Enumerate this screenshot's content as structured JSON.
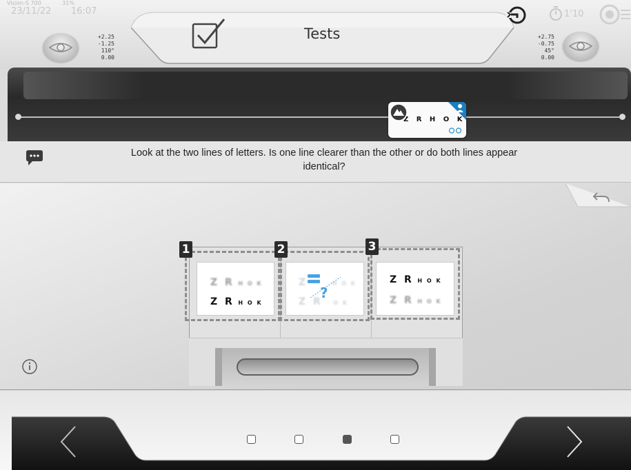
{
  "status": {
    "device_label": "Vision-S 700",
    "battery": "31%",
    "date": "23/11/22",
    "time": "16:07",
    "timer": "1'10"
  },
  "header": {
    "title": "Tests"
  },
  "prescription_left": [
    "+2.25",
    "-1.25",
    "110°",
    "0.00"
  ],
  "prescription_right": [
    "+2.75",
    "-0.75",
    "45°",
    "0.00"
  ],
  "display": {
    "thumbnail_letters": "Z R H O K",
    "accent_color": "#1b7fc0"
  },
  "question": {
    "line1": "Look at the two lines of letters. Is one line clearer than the other or do both lines appear",
    "line2": "identical?"
  },
  "options": [
    {
      "number": "1",
      "top_big": "Z R",
      "top_small": "H O K",
      "bottom_big": "Z R",
      "bottom_small": "H O K"
    },
    {
      "number": "2",
      "top_big": "Z",
      "top_small": "H O K",
      "bottom_big": "Z R",
      "bottom_small": "O K"
    },
    {
      "number": "3",
      "top_big": "Z R",
      "top_small": "H O K",
      "bottom_big": "Z R",
      "bottom_small": "H O K"
    }
  ],
  "pagination": {
    "total": 4,
    "current": 3
  },
  "icons": {
    "check": "check-box-icon",
    "sync": "sync-icon",
    "timer": "stopwatch-icon",
    "target": "target-icon",
    "chat": "speech-bubble-icon",
    "back": "back-arrow-icon",
    "info": "info-icon",
    "prev": "chevron-left-icon",
    "next": "chevron-right-icon"
  }
}
